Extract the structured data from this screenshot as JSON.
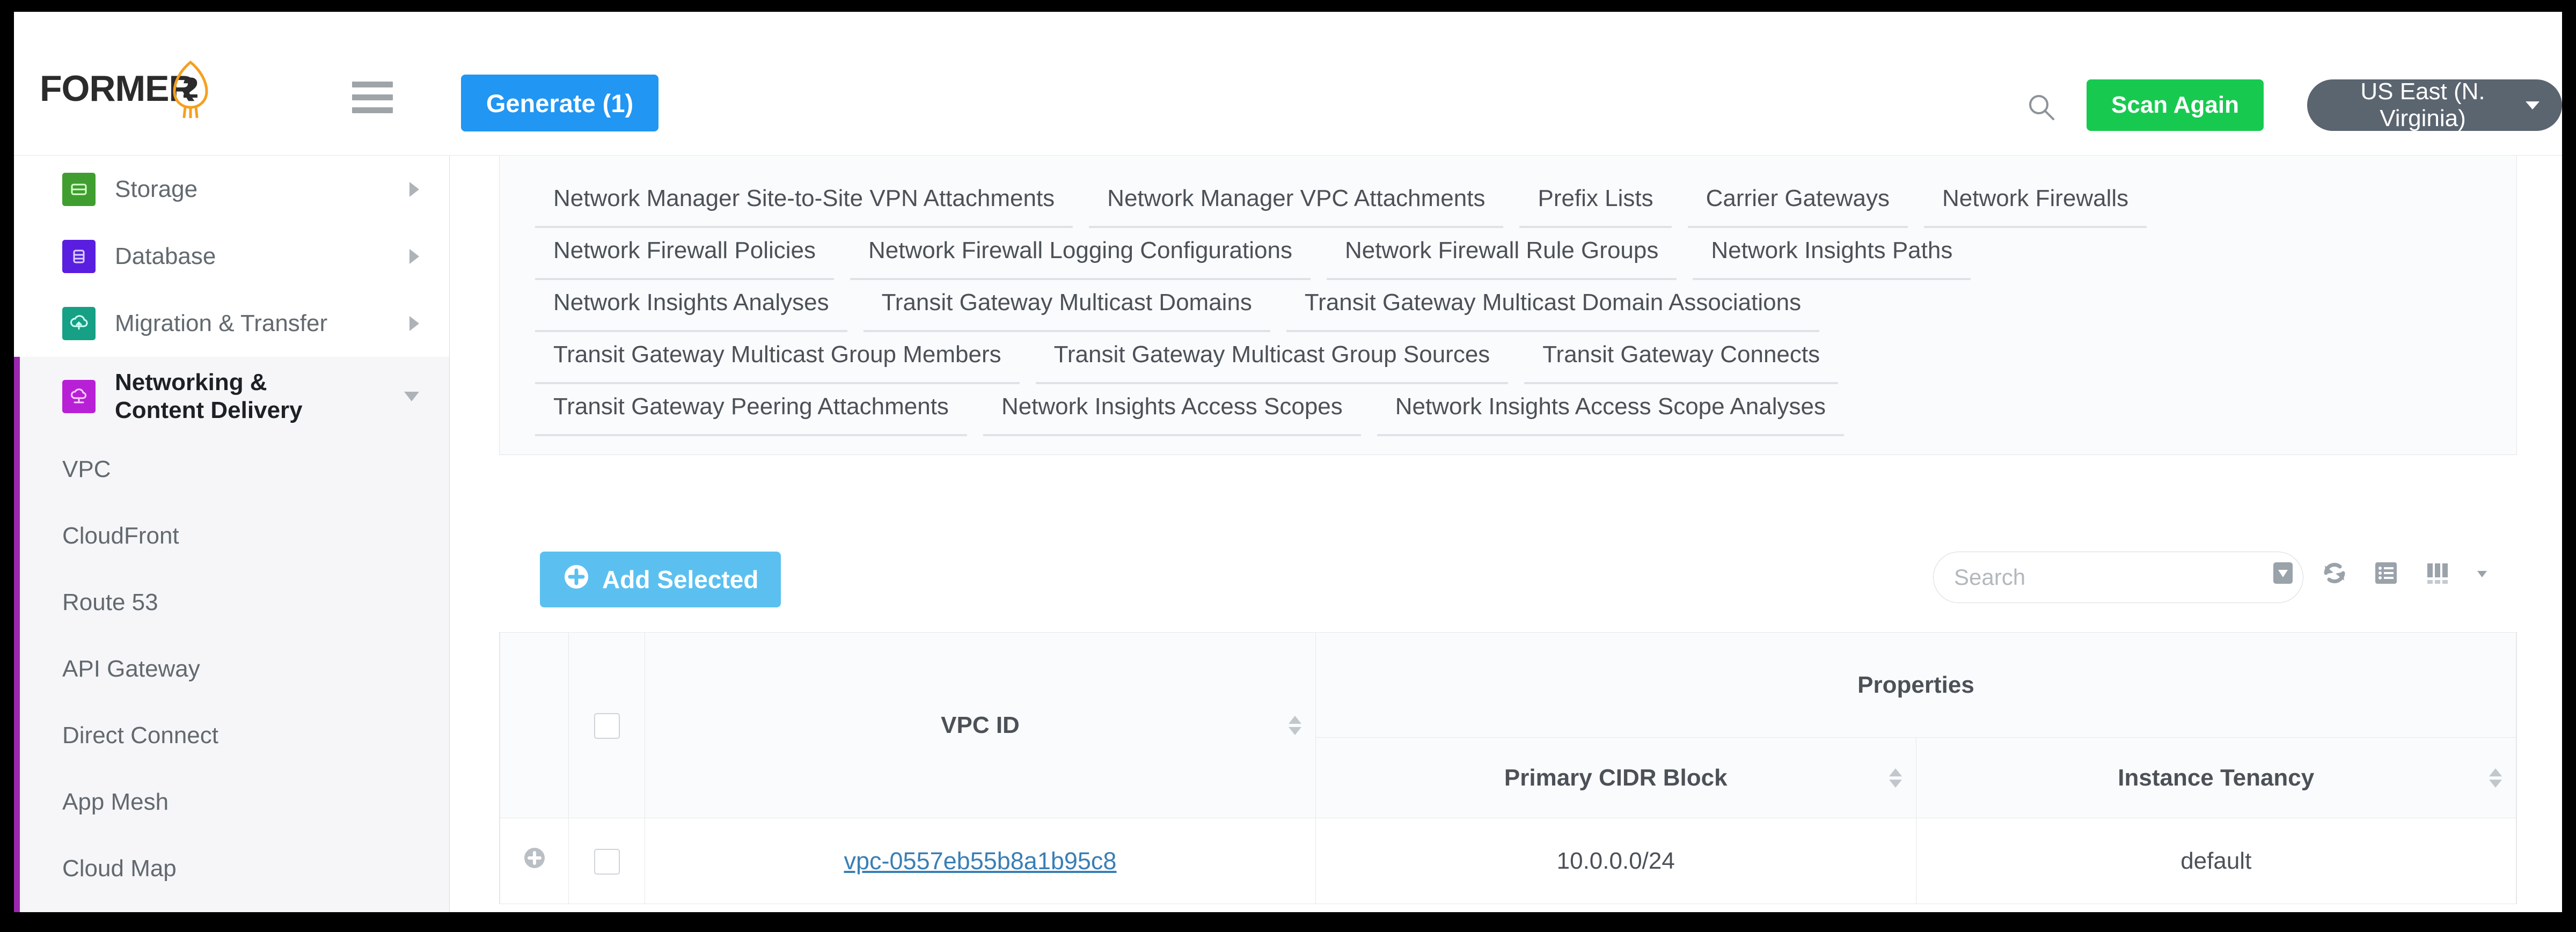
{
  "header": {
    "logo_text": "FORMER",
    "logo_number": "2",
    "menu_icon": "hamburger-icon",
    "generate_label": "Generate (1)",
    "search_icon": "search-icon",
    "scan_label": "Scan Again",
    "region_label": "US East (N. Virginia)",
    "accent_blue": "#2196f3",
    "accent_green": "#18c950",
    "region_bg": "#5b6570"
  },
  "sidebar": {
    "categories": [
      {
        "label": "Storage",
        "icon": "storage-icon",
        "color": "#3f9e2f",
        "active": false
      },
      {
        "label": "Database",
        "icon": "database-icon",
        "color": "#5a1ee0",
        "active": false
      },
      {
        "label": "Migration & Transfer",
        "icon": "migration-icon",
        "color": "#16a085",
        "active": false
      },
      {
        "label": "Networking & Content Delivery",
        "icon": "networking-icon",
        "color": "#b820d6",
        "active": true
      }
    ],
    "active_label_line1": "Networking &",
    "active_label_line2": "Content Delivery",
    "sub_items": [
      {
        "label": "VPC"
      },
      {
        "label": "CloudFront"
      },
      {
        "label": "Route 53"
      },
      {
        "label": "API Gateway"
      },
      {
        "label": "Direct Connect"
      },
      {
        "label": "App Mesh"
      },
      {
        "label": "Cloud Map"
      }
    ],
    "active_accent": "#9b27b0"
  },
  "main": {
    "tab_rows": [
      [
        "Network Manager Site-to-Site VPN Attachments",
        "Network Manager VPC Attachments",
        "Prefix Lists",
        "Carrier Gateways",
        "Network Firewalls"
      ],
      [
        "Network Firewall Policies",
        "Network Firewall Logging Configurations",
        "Network Firewall Rule Groups",
        "Network Insights Paths"
      ],
      [
        "Network Insights Analyses",
        "Transit Gateway Multicast Domains",
        "Transit Gateway Multicast Domain Associations"
      ],
      [
        "Transit Gateway Multicast Group Members",
        "Transit Gateway Multicast Group Sources",
        "Transit Gateway Connects"
      ],
      [
        "Transit Gateway Peering Attachments",
        "Network Insights Access Scopes",
        "Network Insights Access Scope Analyses"
      ]
    ],
    "toolbar": {
      "add_selected_label": "Add Selected",
      "add_icon": "plus-circle-icon",
      "search_placeholder": "Search",
      "search_value": "",
      "icons": [
        {
          "name": "export-download-icon"
        },
        {
          "name": "refresh-icon"
        },
        {
          "name": "list-view-icon"
        },
        {
          "name": "columns-icon"
        }
      ]
    },
    "table": {
      "group_header": "Properties",
      "columns": {
        "id": "VPC ID",
        "primary_cidr": "Primary CIDR Block",
        "instance_tenancy": "Instance Tenancy"
      },
      "rows": [
        {
          "vpc_id": "vpc-0557eb55b8a1b95c8",
          "primary_cidr": "10.0.0.0/24",
          "instance_tenancy": "default"
        }
      ]
    }
  }
}
